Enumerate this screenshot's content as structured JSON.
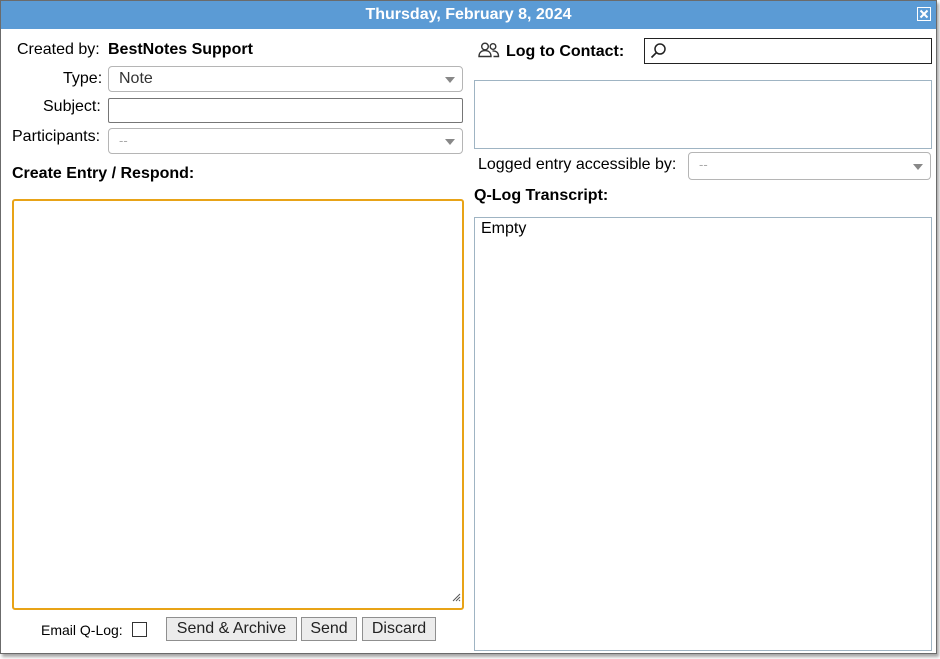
{
  "title": "Thursday, February 8, 2024",
  "icons": {
    "close": "close-icon",
    "contacts": "contacts-icon",
    "search": "search-icon",
    "resize": "resize-grip-icon"
  },
  "colors": {
    "titlebar": "#5b9bd5",
    "focus_border": "#e8a317"
  },
  "left": {
    "created_by_label": "Created by:",
    "created_by_value": "BestNotes Support",
    "type_label": "Type:",
    "type_value": "Note",
    "subject_label": "Subject:",
    "subject_value": "",
    "participants_label": "Participants:",
    "participants_value": "--",
    "entry_heading": "Create Entry / Respond:",
    "entry_value": ""
  },
  "footer": {
    "email_qlog_label": "Email Q-Log:",
    "email_qlog_checked": false,
    "send_archive_label": "Send & Archive",
    "send_label": "Send",
    "discard_label": "Discard"
  },
  "right": {
    "log_to_contact_label": "Log to Contact:",
    "search_value": "",
    "accessible_label": "Logged entry accessible by:",
    "accessible_value": "--",
    "transcript_heading": "Q-Log Transcript:",
    "transcript_text": "Empty"
  }
}
